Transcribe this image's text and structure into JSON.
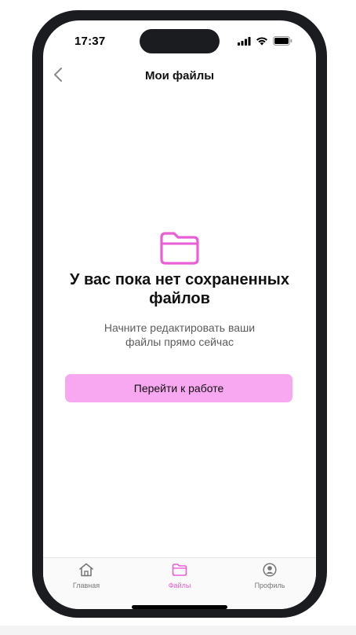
{
  "status_bar": {
    "time": "17:37"
  },
  "nav": {
    "title": "Мои файлы"
  },
  "empty_state": {
    "title": "У вас пока нет сохраненных файлов",
    "subtitle": "Начните редактировать ваши файлы прямо сейчас",
    "button_label": "Перейти к работе",
    "icon": "folder-icon"
  },
  "tab_bar": {
    "items": [
      {
        "label": "Главная",
        "icon": "home-icon",
        "active": false
      },
      {
        "label": "Файлы",
        "icon": "folder-icon",
        "active": true
      },
      {
        "label": "Профиль",
        "icon": "profile-icon",
        "active": false
      }
    ]
  },
  "colors": {
    "accent": "#e85fd6",
    "button_bg": "#f8a8f1",
    "frame": "#1b1c20"
  }
}
